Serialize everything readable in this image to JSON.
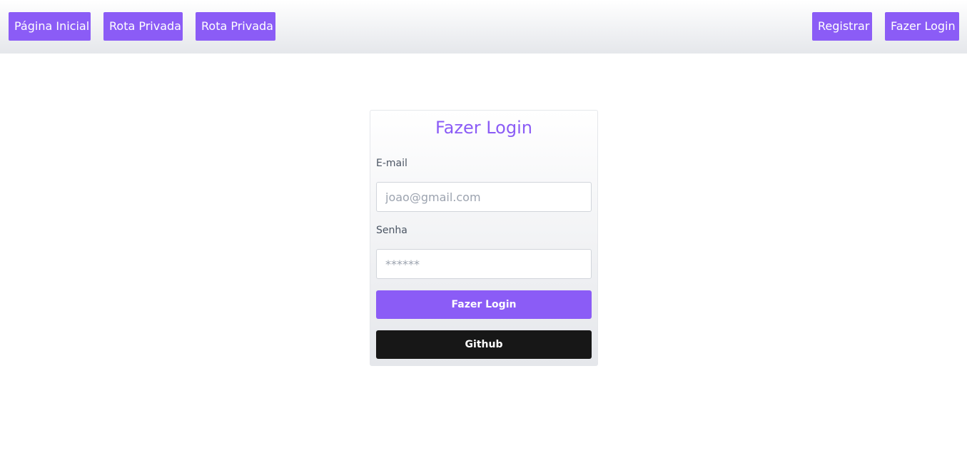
{
  "nav": {
    "left_items": [
      {
        "label": "Página Inicial"
      },
      {
        "label": "Rota Privada"
      },
      {
        "label": "Rota Privada"
      }
    ],
    "right_items": [
      {
        "label": "Registrar"
      },
      {
        "label": "Fazer Login"
      }
    ]
  },
  "login_form": {
    "title": "Fazer Login",
    "email": {
      "label": "E-mail",
      "placeholder": "joao@gmail.com",
      "value": ""
    },
    "password": {
      "label": "Senha",
      "placeholder": "******",
      "value": ""
    },
    "submit_label": "Fazer Login",
    "github_label": "Github"
  },
  "colors": {
    "accent": "#8b5cf6",
    "github_button": "#171717",
    "label_text": "#4b5563"
  }
}
